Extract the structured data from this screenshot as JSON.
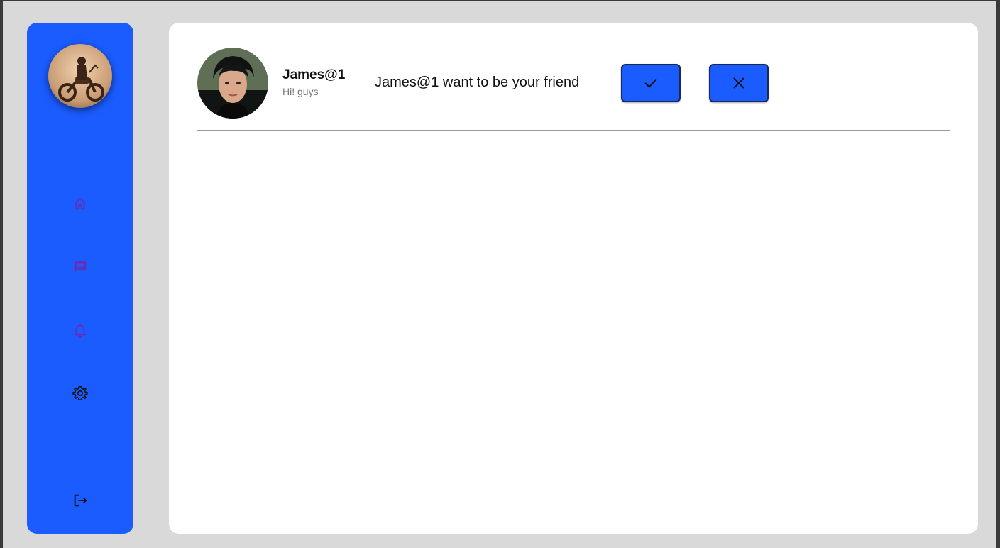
{
  "sidebar": {
    "profile_avatar_alt": "profile photo of rider with motorcycle",
    "nav": [
      {
        "name": "home",
        "icon": "home-icon"
      },
      {
        "name": "messages",
        "icon": "chat-icon"
      },
      {
        "name": "notifications",
        "icon": "bell-icon"
      },
      {
        "name": "settings",
        "icon": "gear-icon"
      }
    ],
    "logout_icon": "logout-icon"
  },
  "friend_request": {
    "name": "James@1",
    "status": "Hi! guys",
    "message": "James@1 want to be your friend",
    "accept_icon": "check-icon",
    "decline_icon": "close-icon"
  },
  "colors": {
    "background": "#d9d9d9",
    "sidebar": "#1a5cff",
    "nav_icon_active": "#6a2bb0",
    "panel": "#ffffff",
    "button": "#1a5cff"
  }
}
